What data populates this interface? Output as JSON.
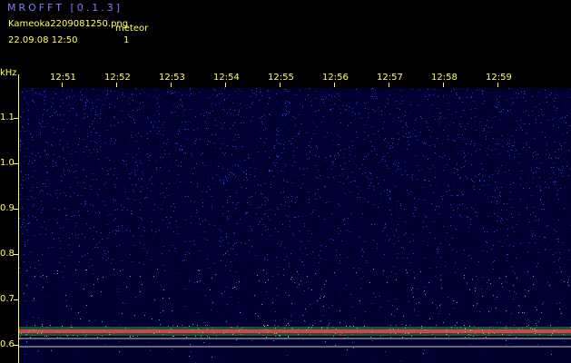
{
  "header": {
    "app_title": "MROFFT [0.1.3]",
    "filename": "Kameoka2209081250.png",
    "meteor_label": "meteor",
    "datetime": "22.09.08 12:50",
    "meteor_count": "1"
  },
  "axis": {
    "unit": "kHz",
    "frequency_ticks": [
      "1.1",
      "1.0",
      "0.9",
      "0.8",
      "0.7",
      "0.6"
    ],
    "time_ticks": [
      "12:51",
      "12:52",
      "12:53",
      "12:54",
      "12:55",
      "12:56",
      "12:57",
      "12:58",
      "12:59"
    ]
  },
  "spectrogram": {
    "carrier_frequency_khz": 0.63,
    "colors": {
      "background": "#000030",
      "noise_dark": "#10106a",
      "noise_mid": "#2a3cff",
      "noise_bright": "#2fb0ff",
      "carrier_core": "#ff3a5a",
      "carrier_halo": "#30ff30",
      "reference_line": "#c8c8c8",
      "label_text": "#ffff66",
      "title_text": "#7d7dff"
    }
  }
}
